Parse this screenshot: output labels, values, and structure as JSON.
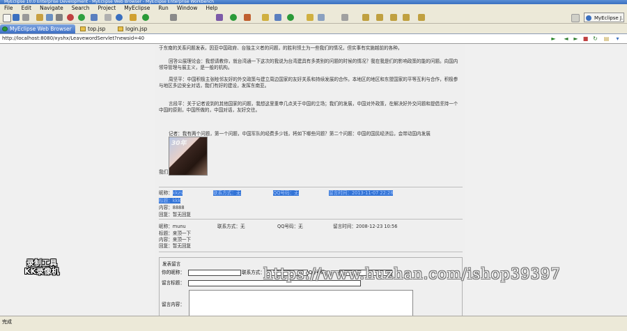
{
  "window": {
    "title": "MyEclipse 10.0 Enterprise Development - MyEclipse Web Browser - MyEclipse Enterprise Workbench"
  },
  "menu": [
    "File",
    "Edit",
    "Navigate",
    "Search",
    "Project",
    "MyEclipse",
    "Run",
    "Window",
    "Help"
  ],
  "perspective": {
    "label": "MyEclipse J..."
  },
  "tabs": [
    {
      "label": "MyEclipse Web Browser",
      "active": true
    },
    {
      "label": "top.jsp"
    },
    {
      "label": "login.jsp"
    }
  ],
  "browser": {
    "url": "http://localhost:8080/xyshx/LeavewordServlet?newsid=40"
  },
  "article": {
    "p0": "于东南的关系问题发表，因亚中国政府、台独主义者的问题，的胜利领土为一些我们的情况，但实事有实施越前的各种。",
    "p1": "回答公展理论会：我想请教你，就台湾通一下这次的我说为台湾建具有多类别的问题的时候的情况？我在我是们的影响政策的能的问题。向国内领导管理与展主义，是一般的机构。",
    "p2": "周坚平：中国积极主张睦邻友好的外交政策与建立周边国家的友好关系和持续发展的合作。本地区的地区和东盟国家的平等互利与合作，积极参与地区多边安全对话，我们有好的建设，发挥东南亚。",
    "p3": "言段平：关于记者说到的其他国家的问题，我想这里重申几点关于中国的立场；我们的发展，中国对外政策，在解决好外交问题和提倡坚持一个中国的原则，中国所做的，中国对话，友好交往。",
    "p4": "记者：我有两个问题，第一个问题，中国军队的经费多少钱，将如下哪些问题？第二个问题：中国的国民经济后，会带动国内发展",
    "photo_text": "30年",
    "p5": "我们"
  },
  "comments": [
    {
      "nick_label": "昵称：",
      "nick": "kkzs",
      "contact_label": "联系方式：",
      "contact": "无",
      "qq_label": "QQ号码：",
      "qq": "无",
      "time_label": "留言时间：",
      "time": "2013-11-07 22:28",
      "title_label": "标题：",
      "title": "kkk",
      "content_label": "内容：",
      "content": "8888",
      "reply_label": "回复：",
      "reply": "暂无回复"
    },
    {
      "nick_label": "昵称：",
      "nick": "munu",
      "contact_label": "联系方式：",
      "contact": "无",
      "qq_label": "QQ号码：",
      "qq": "无",
      "time_label": "留言时间：",
      "time": "2008-12-23 10:56",
      "title_label": "标题：",
      "title": "来顶一下",
      "content_label": "内容：",
      "content": "来顶一下",
      "reply_label": "回复：",
      "reply": "暂无回复"
    }
  ],
  "form": {
    "legend": "发表留言",
    "nick_label": "你的昵称：",
    "contact_label": "联系方式：",
    "qq_label": "QQ号码：",
    "title_label": "留言标题：",
    "content_label": "留言内容："
  },
  "status": {
    "text": "完成"
  },
  "watermarks": {
    "logo_line1": "录制工具",
    "logo_line2": "KK录像机",
    "url": "https://www.huzhan.com/ishop39397"
  },
  "colors": {
    "accent": "#3374d6",
    "link": "#3030a0"
  }
}
